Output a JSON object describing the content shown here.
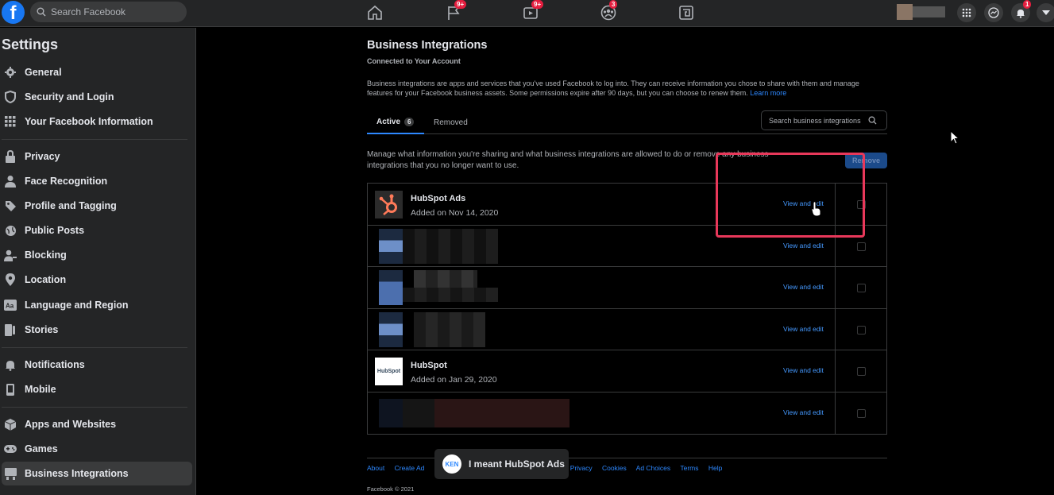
{
  "topbar": {
    "logo": "f",
    "search_placeholder": "Search Facebook",
    "badges": {
      "pages": "9+",
      "watch": "9+",
      "groups": "3",
      "notifications": "1"
    }
  },
  "sidebar": {
    "title": "Settings",
    "items": [
      {
        "label": "General",
        "icon": "gear-icon"
      },
      {
        "label": "Security and Login",
        "icon": "shield-icon"
      },
      {
        "label": "Your Facebook Information",
        "icon": "grid-icon"
      },
      {
        "label": "Privacy",
        "icon": "lock-icon"
      },
      {
        "label": "Face Recognition",
        "icon": "user-icon"
      },
      {
        "label": "Profile and Tagging",
        "icon": "tag-icon"
      },
      {
        "label": "Public Posts",
        "icon": "globe-icon"
      },
      {
        "label": "Blocking",
        "icon": "block-user-icon"
      },
      {
        "label": "Location",
        "icon": "pin-icon"
      },
      {
        "label": "Language and Region",
        "icon": "language-icon"
      },
      {
        "label": "Stories",
        "icon": "book-icon"
      },
      {
        "label": "Notifications",
        "icon": "bell-icon"
      },
      {
        "label": "Mobile",
        "icon": "phone-icon"
      },
      {
        "label": "Apps and Websites",
        "icon": "cube-icon"
      },
      {
        "label": "Games",
        "icon": "gamepad-icon"
      },
      {
        "label": "Business Integrations",
        "icon": "integrations-icon",
        "active": true
      }
    ]
  },
  "main": {
    "title": "Business Integrations",
    "subtitle": "Connected to Your Account",
    "description": "Business integrations are apps and services that you've used Facebook to log into. They can receive information you chose to share with them and manage features for your Facebook business assets. Some permissions expire after 90 days, but you can choose to renew them.",
    "learn_more": "Learn more",
    "tabs": [
      {
        "label": "Active",
        "count": "6"
      },
      {
        "label": "Removed"
      }
    ],
    "search_placeholder": "Search business integrations",
    "manage_text": "Manage what information you're sharing and what business integrations are allowed to do or remove any business integrations that you no longer want to use.",
    "remove_label": "Remove",
    "view_label": "View and edit",
    "integrations": [
      {
        "name": "HubSpot Ads",
        "added": "Added on Nov 14, 2020"
      },
      {
        "name": "",
        "added": ""
      },
      {
        "name": "",
        "added": ""
      },
      {
        "name": "",
        "added": ""
      },
      {
        "name": "HubSpot",
        "added": "Added on Jan 29, 2020",
        "logo_text": "HubSpot"
      },
      {
        "name": "",
        "added": ""
      }
    ]
  },
  "footer": {
    "links": [
      "About",
      "Create Ad",
      "Privacy",
      "Cookies",
      "Ad Choices",
      "Terms",
      "Help"
    ],
    "copyright": "Facebook © 2021"
  },
  "toast": {
    "badge": "KEN",
    "message": "I meant HubSpot Ads"
  },
  "colors": {
    "accent": "#2d88ff",
    "highlight": "#e8385a",
    "hubspot": "#ff7a59"
  }
}
